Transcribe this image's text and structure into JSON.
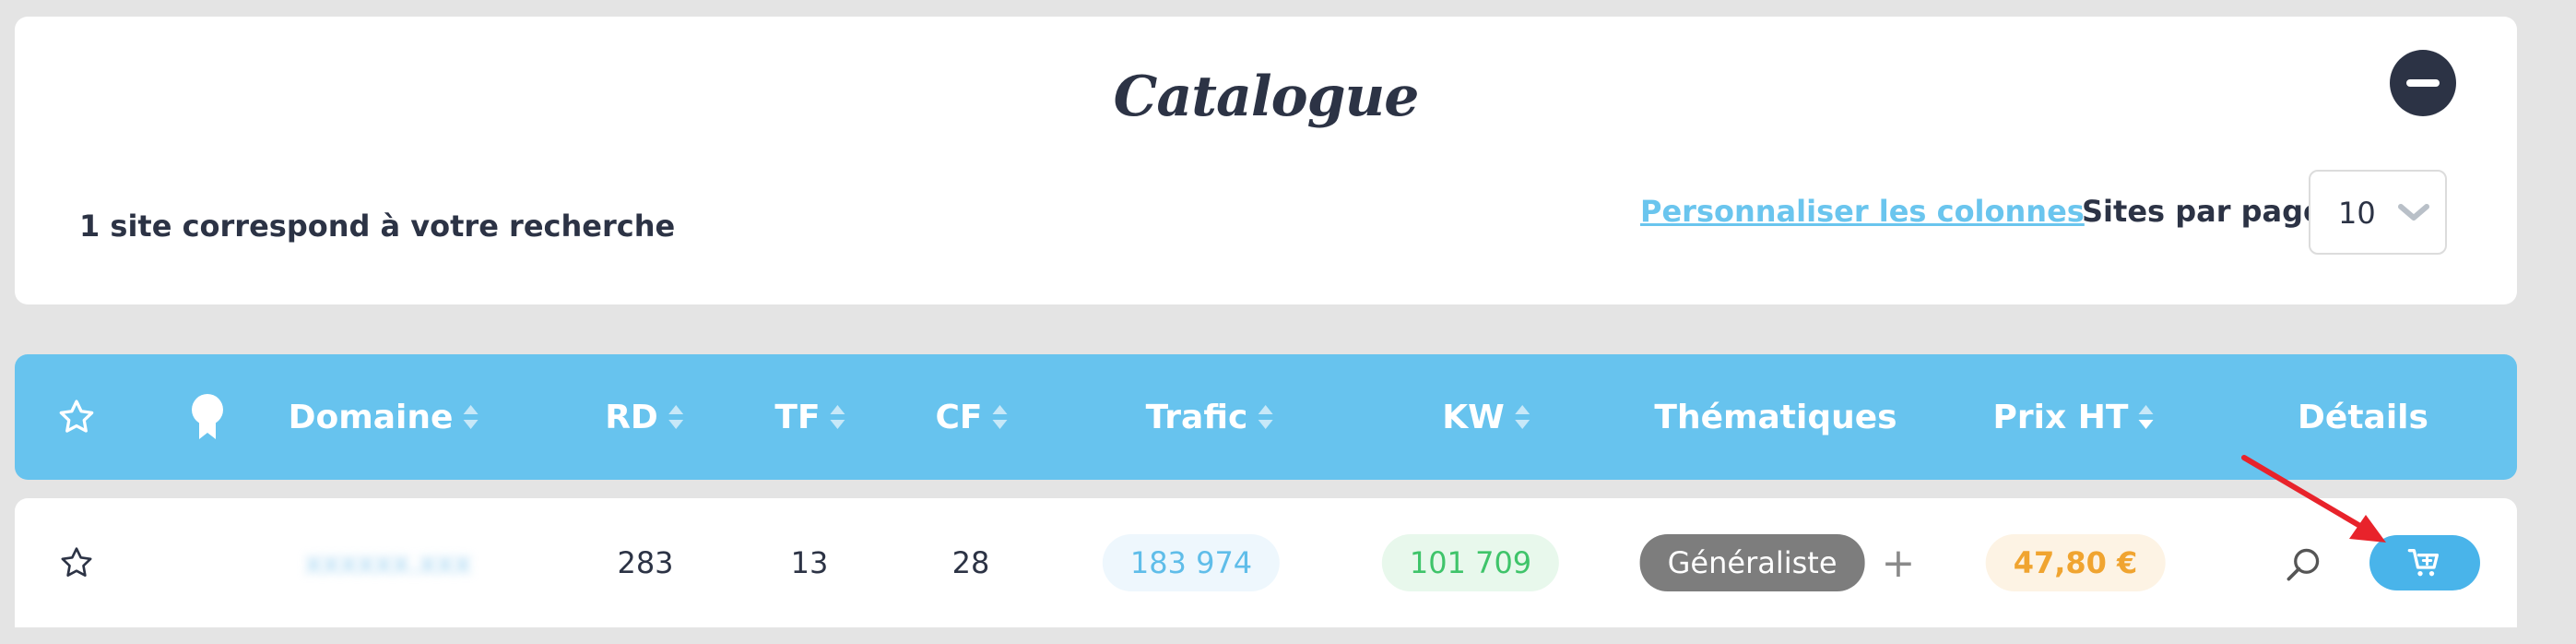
{
  "header": {
    "title": "Catalogue",
    "result_count": "1 site correspond à votre recherche",
    "customize_columns": "Personnaliser les colonnes",
    "per_page_label": "Sites par page",
    "per_page_value": "10"
  },
  "table": {
    "columns": [
      "Domaine",
      "RD",
      "TF",
      "CF",
      "Trafic",
      "KW",
      "Thématiques",
      "Prix HT",
      "Détails"
    ],
    "rows": [
      {
        "domain": "xxxxxx.xxx",
        "rd": "283",
        "tf": "13",
        "cf": "28",
        "trafic": "183 974",
        "kw": "101 709",
        "thematique": "Généraliste",
        "plus": "+",
        "prix": "47,80 €"
      }
    ]
  },
  "colors": {
    "header_bg": "#67c3ee",
    "accent_blue": "#49b4ea",
    "dark": "#2c3345",
    "annotation_arrow": "#e8232b"
  },
  "icons": {
    "favorite": "star-outline-icon",
    "rank": "award-ribbon-icon",
    "collapse": "minus-circle-icon",
    "details": "search-icon",
    "cart": "cart-add-icon"
  }
}
